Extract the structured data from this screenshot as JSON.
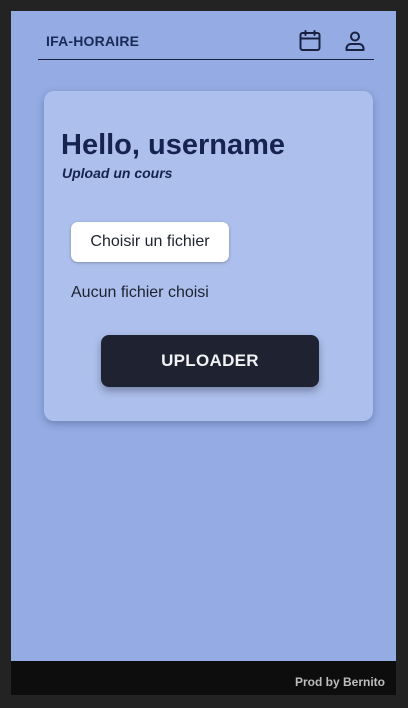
{
  "header": {
    "title": "IFA-HORAIRE",
    "calendar_icon": "calendar-icon",
    "profile_icon": "user-icon"
  },
  "card": {
    "greeting": "Hello, username",
    "subtitle": "Upload un cours",
    "file_button_label": "Choisir un fichier",
    "file_status": "Aucun fichier choisi",
    "upload_button_label": "UPLOADER"
  },
  "footer": {
    "credit": "Prod by Bernito"
  },
  "colors": {
    "background": "#94ace3",
    "card": "#adbfec",
    "primary_button": "#1f2231",
    "text_dark": "#16234f"
  }
}
